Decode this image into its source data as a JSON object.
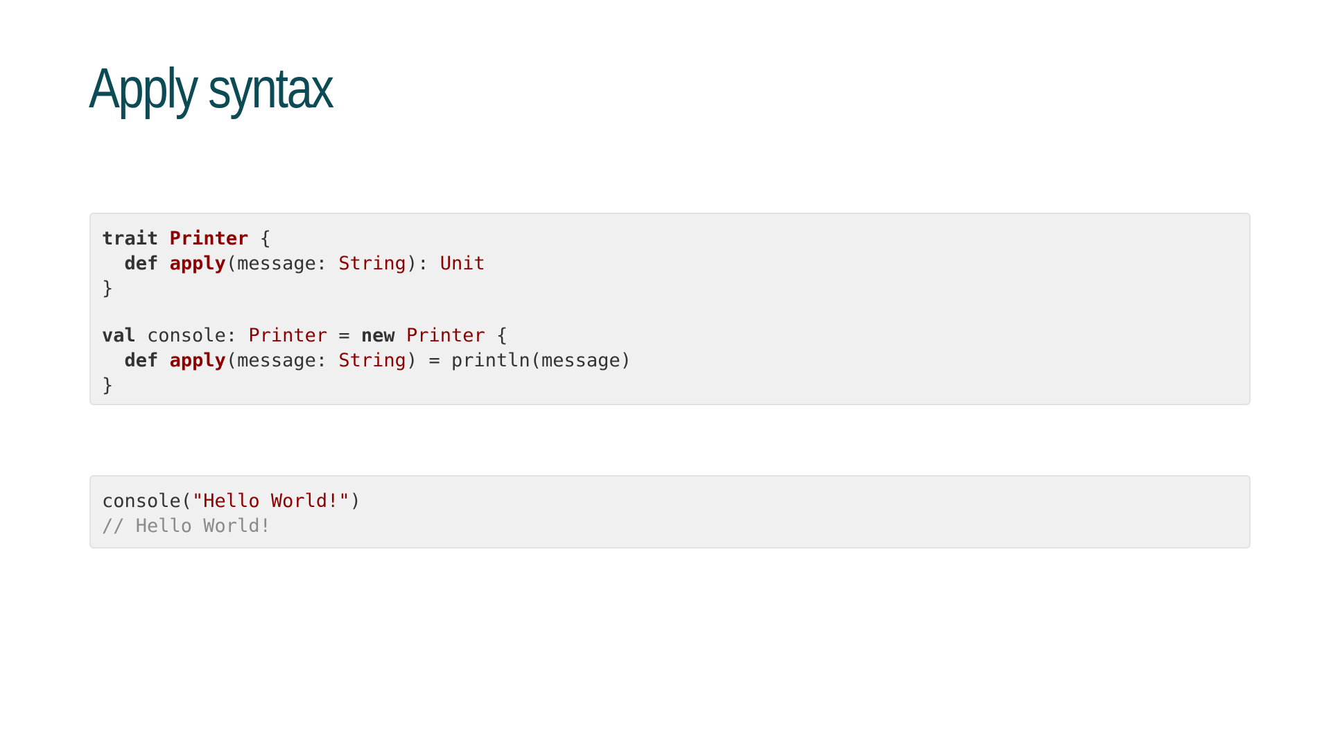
{
  "slide": {
    "title": "Apply syntax"
  },
  "code_block_1": {
    "line1": {
      "kw": "trait",
      "sp1": " ",
      "name": "Printer",
      "rest": " {"
    },
    "line2": {
      "indent": "  ",
      "kw": "def",
      "sp1": " ",
      "fn": "apply",
      "p1": "(message: ",
      "t1": "String",
      "p2": "): ",
      "t2": "Unit"
    },
    "line3": {
      "text": "}"
    },
    "line4": {
      "kw1": "val",
      "p1": " console: ",
      "t1": "Printer",
      "p2": " = ",
      "kw2": "new",
      "sp": " ",
      "t2": "Printer",
      "p3": " {"
    },
    "line5": {
      "indent": "  ",
      "kw": "def",
      "sp1": " ",
      "fn": "apply",
      "p1": "(message: ",
      "t1": "String",
      "p2": ") = println(message)"
    },
    "line6": {
      "text": "}"
    }
  },
  "code_block_2": {
    "line1": {
      "p1": "console(",
      "str": "\"Hello World!\"",
      "p2": ")"
    },
    "line2": {
      "comment": "// Hello World!"
    }
  },
  "colors": {
    "title": "#0c4a55",
    "code_background": "#f0f0f0",
    "keyword": "#333333",
    "type": "#8b0000",
    "string": "#8b0000",
    "comment": "#8a8a8a"
  }
}
